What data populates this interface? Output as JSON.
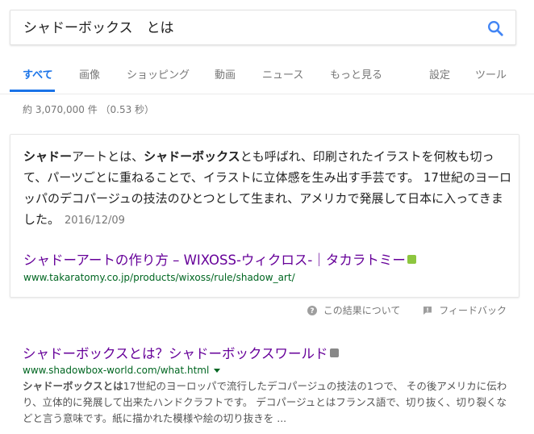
{
  "search": {
    "query": "シャドーボックス　とは"
  },
  "tabs": [
    {
      "label": "すべて"
    },
    {
      "label": "画像"
    },
    {
      "label": "ショッピング"
    },
    {
      "label": "動画"
    },
    {
      "label": "ニュース"
    },
    {
      "label": "もっと見る"
    },
    {
      "label": "設定"
    },
    {
      "label": "ツール"
    }
  ],
  "result_stats": "約 3,070,000 件 （0.53 秒）",
  "featured": {
    "snippet_parts": [
      "シャドー",
      "アートとは、",
      "シャドーボックス",
      "とも呼ばれ、印刷されたイラストを何枚も切って、パーツごとに重ねることで、イラストに立体感を生み出す手芸です。 17世紀のヨーロッパのデコパージュの技法のひとつとして生まれ、アメリカで発展して日本に入ってきました。"
    ],
    "date": "2016/12/09",
    "title": "シャドーアートの作り方 – WIXOSS-ウィクロス-｜タカラトミー",
    "url": "www.takaratomy.co.jp/products/wixoss/rule/shadow_art/"
  },
  "feedback": {
    "about_label": "この結果について",
    "feedback_label": "フィードバック"
  },
  "result2": {
    "title": "シャドーボックスとは？シャドーボックスワールド",
    "url": "www.shadowbox-world.com/what.html",
    "snippet_bold": "シャドーボックスとは",
    "snippet_rest": "17世紀のヨーロッパで流行したデコパージュの技法の1つで、 その後アメリカに伝わり、立体的に発展して出来たハンドクラフトです。 デコパージュとはフランス語で、切り抜く、切り裂くなどと言う意味です。紙に描かれた模様や絵の切り抜きを ..."
  },
  "colors": {
    "accent": "#1a73e8",
    "visited_link": "#660099",
    "url_green": "#006621"
  }
}
